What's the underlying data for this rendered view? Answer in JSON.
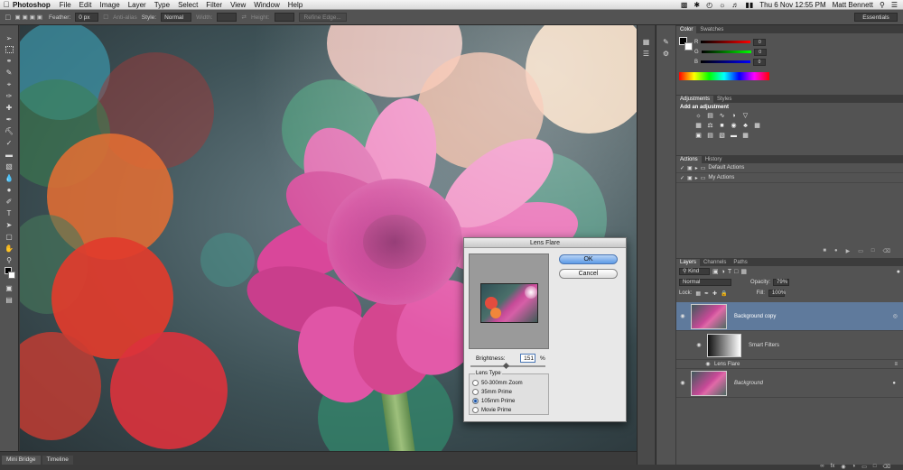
{
  "menubar": {
    "app": "Photoshop",
    "menus": [
      "File",
      "Edit",
      "Image",
      "Layer",
      "Type",
      "Select",
      "Filter",
      "View",
      "Window",
      "Help"
    ],
    "clock": "Thu 6 Nov  12:55 PM",
    "user": "Matt Bennett"
  },
  "options": {
    "feather_label": "Feather:",
    "feather_value": "0 px",
    "antialias_label": "Anti-alias",
    "style_label": "Style:",
    "style_value": "Normal",
    "width_label": "Width:",
    "height_label": "Height:",
    "refine_edge": "Refine Edge...",
    "workspace": "Essentials"
  },
  "document_tabs": [
    "Mini Bridge",
    "Timeline"
  ],
  "color_panel": {
    "tabs": [
      "Color",
      "Swatches"
    ],
    "channels": [
      {
        "label": "R",
        "value": "0"
      },
      {
        "label": "G",
        "value": "0"
      },
      {
        "label": "B",
        "value": "0"
      }
    ]
  },
  "adjustments_panel": {
    "tabs": [
      "Adjustments",
      "Styles"
    ],
    "title": "Add an adjustment"
  },
  "actions_panel": {
    "tabs": [
      "Actions",
      "History"
    ],
    "items": [
      "Default Actions",
      "My Actions"
    ]
  },
  "layers_panel": {
    "tabs": [
      "Layers",
      "Channels",
      "Paths"
    ],
    "kind": "Kind",
    "blend_mode": "Normal",
    "opacity_label": "Opacity:",
    "opacity_value": "79%",
    "lock_label": "Lock:",
    "fill_label": "Fill:",
    "fill_value": "100%",
    "layers": [
      {
        "name": "Background copy"
      },
      {
        "name": "Smart Filters"
      },
      {
        "name": "Lens Flare"
      },
      {
        "name": "Background"
      }
    ]
  },
  "lens_flare_dialog": {
    "title": "Lens Flare",
    "ok": "OK",
    "cancel": "Cancel",
    "brightness_label": "Brightness:",
    "brightness_value": "151",
    "brightness_unit": "%",
    "lens_type_label": "Lens Type",
    "lens_types": [
      "50-300mm Zoom",
      "35mm Prime",
      "105mm Prime",
      "Movie Prime"
    ],
    "selected_lens": "105mm Prime"
  },
  "colors": {
    "panel_bg": "#535353",
    "selected_layer": "#5f7a9c",
    "flower_pink": "#d9479a"
  }
}
